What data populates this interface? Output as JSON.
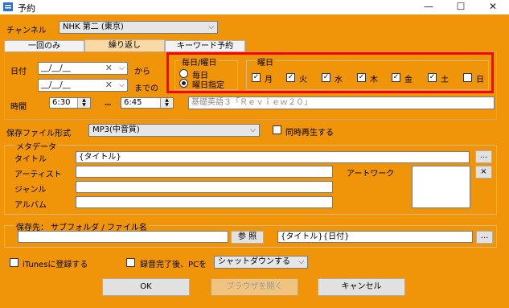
{
  "window": {
    "title": "予約",
    "minimize": "—",
    "maximize": "☐",
    "close": "✕"
  },
  "channel": {
    "label": "チャンネル",
    "value": "NHK 第二 (東京)"
  },
  "tabs": [
    {
      "label": "一回のみ"
    },
    {
      "label": "繰り返し"
    },
    {
      "label": "キーワード予約"
    }
  ],
  "date": {
    "label": "日付",
    "from_value": "__/__/__",
    "to_value": "__/__/__",
    "from_suffix": "から",
    "to_suffix": "までの"
  },
  "time": {
    "label": "時間",
    "start": "6:30",
    "dash": "ー",
    "end": "6:45"
  },
  "program_title_placeholder": "基礎英語３「Ｒｅｖｉｅｗ２０」",
  "schedule_group": {
    "title": "毎日/曜日",
    "everyday": "毎日",
    "weekday_select": "曜日指定"
  },
  "weekday_group": {
    "title": "曜日",
    "days": [
      {
        "label": "月",
        "checked": true
      },
      {
        "label": "火",
        "checked": true
      },
      {
        "label": "水",
        "checked": true
      },
      {
        "label": "木",
        "checked": true
      },
      {
        "label": "金",
        "checked": true
      },
      {
        "label": "土",
        "checked": true
      },
      {
        "label": "日",
        "checked": false
      }
    ]
  },
  "save_format": {
    "label": "保存ファイル形式",
    "value": "MP3(中音質)",
    "simultaneous_play": "同時再生する"
  },
  "metadata": {
    "title": "メタデータ",
    "title_label": "タイトル",
    "title_value": "{タイトル}",
    "artist_label": "アーティスト",
    "genre_label": "ジャンル",
    "album_label": "アルバム",
    "artwork_label": "アートワーク",
    "browse": "...",
    "clear": "×"
  },
  "save_dest": {
    "title": "保存先： サブフォルダ / ファイル名",
    "browse_button": "参 照",
    "filename_value": "{タイトル}{日付}",
    "browse2": "..."
  },
  "itunes": {
    "label": "iTunesに登録する"
  },
  "after_record": {
    "label": "録音完了後、PCを",
    "value": "シャットダウンする"
  },
  "buttons": {
    "ok": "OK",
    "open_browser": "ブラウザを開く",
    "cancel": "キャンセル"
  }
}
